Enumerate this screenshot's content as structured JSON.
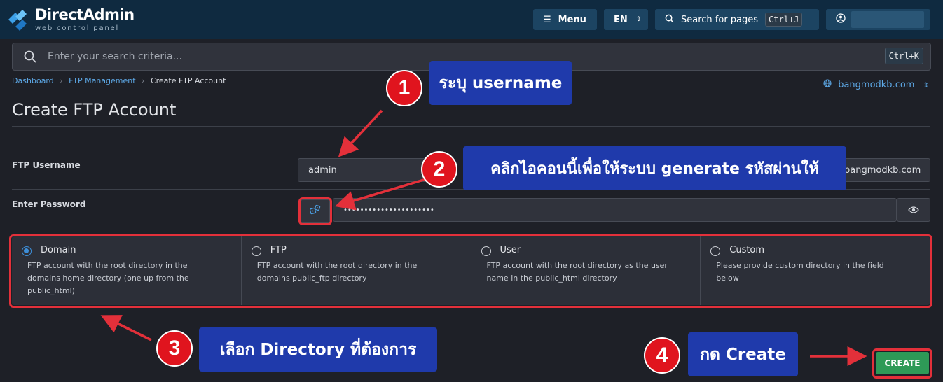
{
  "app": {
    "logo_title": "DirectAdmin",
    "logo_subtitle": "web control panel"
  },
  "topbar": {
    "menu_label": "Menu",
    "lang_label": "EN",
    "search_pages_label": "Search for pages",
    "search_pages_shortcut": "Ctrl+J"
  },
  "search": {
    "placeholder": "Enter your search criteria...",
    "shortcut": "Ctrl+K"
  },
  "breadcrumb": {
    "items": [
      "Dashboard",
      "FTP Management"
    ],
    "current": "Create FTP Account"
  },
  "domain_selector": "bangmodkb.com",
  "page_title": "Create FTP Account",
  "form": {
    "username_label": "FTP Username",
    "username_value": "admin",
    "username_suffix": "bangmodkb.com",
    "password_label": "Enter Password",
    "password_value": "••••••••••••••••••••••"
  },
  "directory_options": [
    {
      "title": "Domain",
      "desc": "FTP account with the root directory in the domains home directory (one up from the public_html)",
      "selected": true
    },
    {
      "title": "FTP",
      "desc": "FTP account with the root directory in the domains public_ftp directory",
      "selected": false
    },
    {
      "title": "User",
      "desc": "FTP account with the root directory as the user name in the public_html directory",
      "selected": false
    },
    {
      "title": "Custom",
      "desc": "Please provide custom directory in the field below",
      "selected": false
    }
  ],
  "create_button": "CREATE",
  "annotations": {
    "step1": {
      "num": "1",
      "text": "ระบุ username"
    },
    "step2": {
      "num": "2",
      "text": "คลิกไอคอนนี้เพื่อให้ระบบ generate รหัสผ่านให้"
    },
    "step3": {
      "num": "3",
      "text": "เลือก Directory ที่ต้องการ"
    },
    "step4": {
      "num": "4",
      "text": "กด Create"
    }
  },
  "colors": {
    "topbar": "#0f2a40",
    "accent": "#3d8ed8",
    "create": "#2e9a57",
    "annotation_red": "#e3303a",
    "callout_blue": "#1f3aab"
  }
}
